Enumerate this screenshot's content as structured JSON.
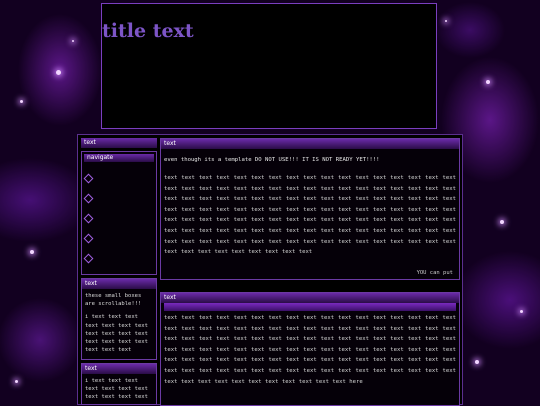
{
  "header": {
    "title": "title text"
  },
  "sidebar": {
    "nav": {
      "heading": "text",
      "label": "navigate",
      "links": [
        "",
        "",
        "",
        "",
        ""
      ]
    },
    "box2": {
      "heading": "text",
      "intro": "these small boxes are scrollable!!!",
      "body": "i text text text text text text text text text text text text text text text text text text"
    },
    "box3": {
      "heading": "text",
      "body": "i text text text text text text text text text text text"
    }
  },
  "main": {
    "post1": {
      "heading": "text",
      "notice": "even though its a template DO NOT USE!!! IT IS NOT READY YET!!!!",
      "body": "text text text text text text text text text text text text text text text text text text text text text text text text text text text text text text text text text text text text text text text text text text text text text text text text text text text text text text text text text text text text text text text text text text text text text text text text text text text text text text text text text text text text text text text text text text text text text text text text text text text text text text text text text text text text text text text text text text text text text text text text text text text text text text text text",
      "copyright": "YOU can put"
    },
    "post2": {
      "heading": "text",
      "body": "text text text text text text text text text text text text text text text text text text text text text text text text text text text text text text text text text text text text text text text text text text text text text text text text text text text text text text text text text text text text text text text text text text text text text text text text text text text text text text text text text text text text text text text text text text text text text text text text text text text text text text text text text text text text text text text text text here"
    }
  },
  "theme": {
    "accent": "#7a2ac0",
    "title_color": "#7d55c7",
    "link_color": "#5a4dff",
    "background": "#120020"
  }
}
